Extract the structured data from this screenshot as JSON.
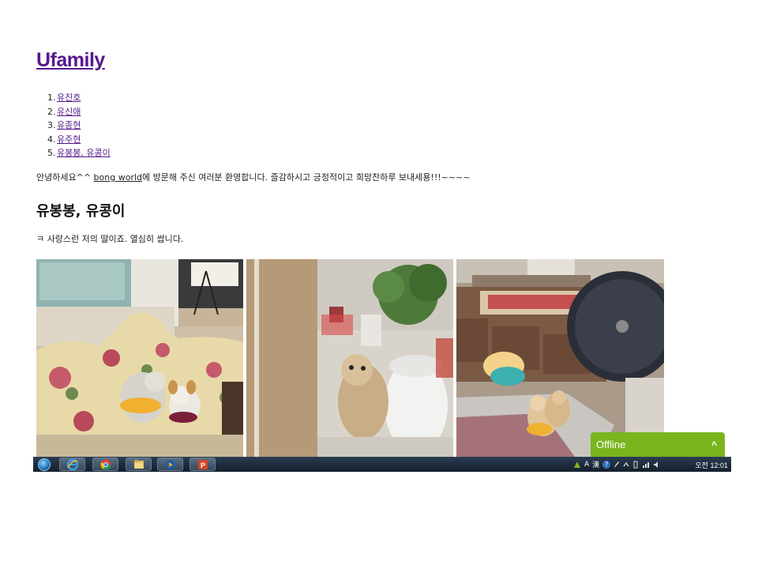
{
  "site": {
    "title": "Ufamily"
  },
  "nav": {
    "items": [
      {
        "num": "1.",
        "label": "유진호"
      },
      {
        "num": "2.",
        "label": "유신애"
      },
      {
        "num": "3.",
        "label": "유종현"
      },
      {
        "num": "4.",
        "label": "유주현"
      },
      {
        "num": "5.",
        "label": "유봉봉, 유콩이"
      }
    ]
  },
  "intro": {
    "before": "안녕하세요^^ ",
    "link": "bong world",
    "after": "에 방문해 주신 여러분 환영합니다. 즐감하시고 긍정적이고 희망찬하루 보내세용!!!~~~~"
  },
  "post": {
    "title": "유봉봉, 유콩이",
    "text": "ㅋ 사랑스런 저의 딸이죠. 열심히 쌉니다."
  },
  "chat": {
    "status": "Offline",
    "chevron": "^"
  },
  "taskbar": {
    "apps": [
      "ie-icon",
      "chrome-icon",
      "folder-icon",
      "media-player-icon",
      "powerpoint-icon"
    ],
    "tray": {
      "ime": "A",
      "hanja": "漢",
      "help": "?"
    },
    "clock": "오전 12:01"
  },
  "colors": {
    "link": "#551a8b",
    "chat_green": "#7ab51d",
    "taskbar": "#1c2a3a"
  }
}
